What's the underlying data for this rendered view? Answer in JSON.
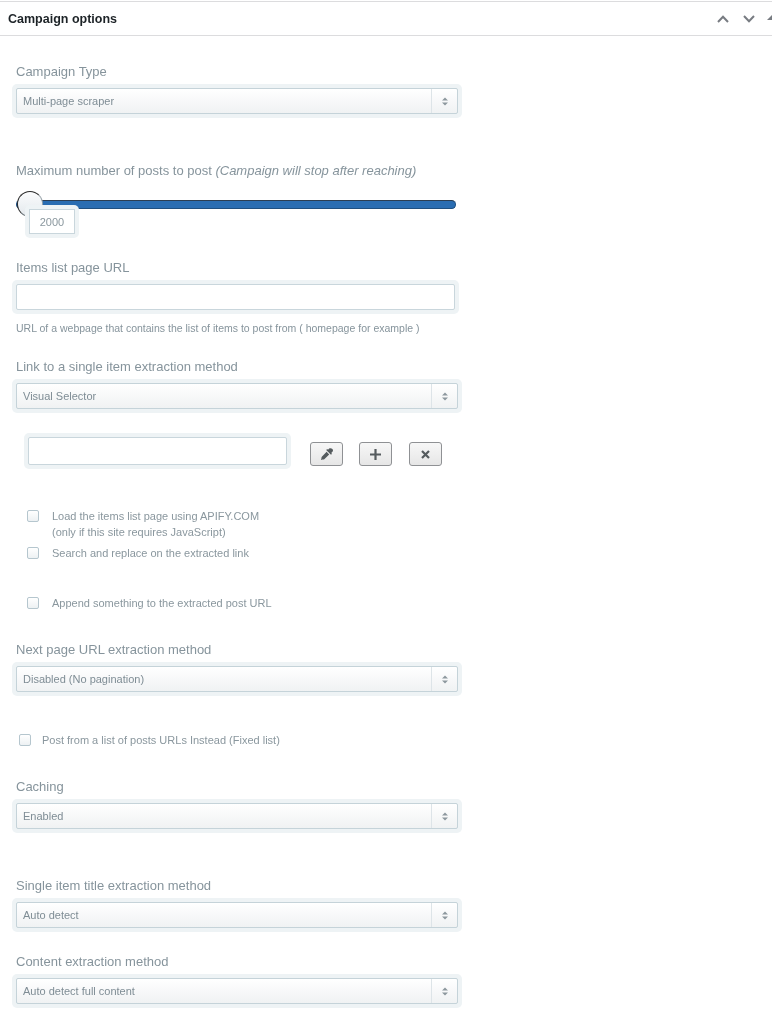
{
  "panel": {
    "title": "Campaign options"
  },
  "fields": [
    {
      "kind": "select",
      "label": "Campaign Type",
      "value": "Multi-page scraper"
    },
    {
      "kind": "slider",
      "label": "Maximum number of posts to post *(Campaign will stop after reaching)*",
      "level": 0,
      "value": "2000"
    },
    {
      "kind": "text",
      "label": "Items list page URL",
      "hint": "URL of a webpage that contains the list of items to post from ( homepage for example )"
    },
    {
      "kind": "select",
      "label": "Link to a single item extraction method",
      "value": "Visual Selector",
      "visual_selector": true,
      "options": [
        {
          "label": "Load the items list page using APIFY.COM",
          "note": "(only if this site requires JavaScript)",
          "checked": false
        },
        {
          "label": "Search and replace on the extracted link",
          "checked": false
        },
        {
          "label": "Append something to the extracted post URL",
          "checked": false
        }
      ]
    },
    {
      "kind": "select",
      "label": "Next page URL extraction method",
      "value": "Disabled (No pagination)"
    },
    {
      "kind": "checkbox",
      "label": "Post from a list of posts URLs Instead (Fixed list)",
      "checked": false
    },
    {
      "kind": "select",
      "label": "Caching",
      "value": "Enabled"
    },
    {
      "kind": "select",
      "label": "Single item title extraction method",
      "value": "Auto detect"
    },
    {
      "kind": "select",
      "label": "Content extraction method",
      "value": "Auto detect full content"
    }
  ]
}
